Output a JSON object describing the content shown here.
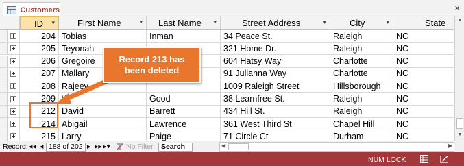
{
  "tab": {
    "label": "Customers",
    "close": "×"
  },
  "columns": [
    {
      "label": "ID",
      "dropdown": "▾"
    },
    {
      "label": "First Name",
      "dropdown": "▾"
    },
    {
      "label": "Last Name",
      "dropdown": "▾"
    },
    {
      "label": "Street Address",
      "dropdown": "▾"
    },
    {
      "label": "City",
      "dropdown": "▾"
    },
    {
      "label": "State"
    }
  ],
  "rows": [
    {
      "id": "204",
      "first": "Tobias",
      "last": "Inman",
      "street": "34 Peace St.",
      "city": "Raleigh",
      "state": "NC"
    },
    {
      "id": "205",
      "first": "Teyonah",
      "last": "",
      "street": "321 Home Dr.",
      "city": "Raleigh",
      "state": "NC"
    },
    {
      "id": "206",
      "first": "Gregoire",
      "last": "",
      "street": "604 Hatsy Way",
      "city": "Charlotte",
      "state": "NC"
    },
    {
      "id": "207",
      "first": "Mallary",
      "last": "",
      "street": "91 Julianna Way",
      "city": "Charlotte",
      "state": "NC"
    },
    {
      "id": "208",
      "first": "Rajeev",
      "last": "",
      "street": "1009 Raleigh Street",
      "city": "Hillsborough",
      "state": "NC"
    },
    {
      "id": "209",
      "first": "W",
      "last": "Good",
      "street": "38 Learnfree St.",
      "city": "Raleigh",
      "state": "NC"
    },
    {
      "id": "212",
      "first": "David",
      "last": "Barrett",
      "street": "434 Hill St.",
      "city": "Raleigh",
      "state": "NC"
    },
    {
      "id": "214",
      "first": "Abigail",
      "last": "Lawrence",
      "street": "361 West Third St",
      "city": "Chapel Hill",
      "state": "NC"
    },
    {
      "id": "215",
      "first": "Larry",
      "last": "Paige",
      "street": "71 Circle Ct",
      "city": "Durham",
      "state": "NC"
    }
  ],
  "callout": {
    "line1": "Record 213 has",
    "line2": "been deleted"
  },
  "navigation": {
    "record_label": "Record:",
    "first": "◀◀",
    "prev": "◀",
    "position": "188 of 202",
    "next": "▶",
    "last": "▶▶",
    "new": "▶✱",
    "filter_status": "No Filter",
    "search_label": "Search"
  },
  "status_bar": {
    "numlock": "NUM LOCK"
  },
  "colors": {
    "accent": "#a4373a",
    "callout": "#e8762c",
    "id_header": "#fbe3a8"
  },
  "icons": [
    "table-icon",
    "close-icon",
    "expand-icon",
    "filter-icon",
    "datasheet-view-icon",
    "design-view-icon"
  ]
}
